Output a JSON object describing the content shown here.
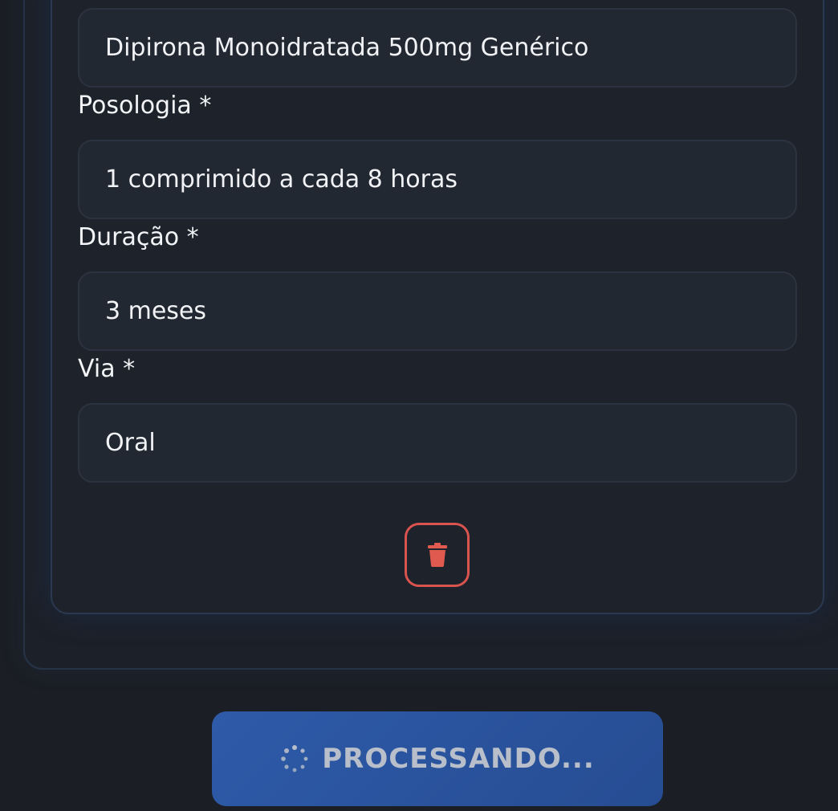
{
  "form": {
    "medication": {
      "value": "Dipirona Monoidratada 500mg Genérico"
    },
    "posology": {
      "label": "Posologia *",
      "value": "1 comprimido a cada 8 horas"
    },
    "duration": {
      "label": "Duração *",
      "value": "3 meses"
    },
    "route": {
      "label": "Via *",
      "value": "Oral"
    },
    "delete_icon": "trash-icon",
    "colors": {
      "delete": "#d9534f",
      "submit": "#2e5aa8"
    }
  },
  "submit": {
    "label": "PROCESSANDO...",
    "icon": "spinner-icon"
  }
}
